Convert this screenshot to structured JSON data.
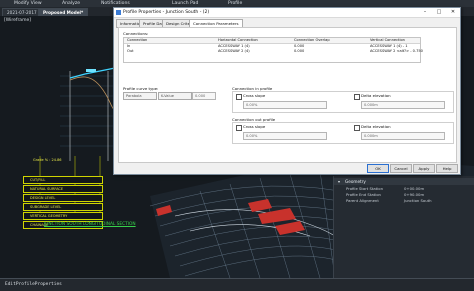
{
  "ribbon": {
    "items": [
      "Modify View",
      "Analyze",
      "Notifications",
      "Launch Pad",
      "Profile"
    ]
  },
  "document_tabs": [
    {
      "label": "2021-07-2017"
    },
    {
      "label": "Proposed Model*",
      "active": true
    }
  ],
  "viewport": {
    "view_label": "[Wireframe]",
    "grade_label": "Grade % : 24.86",
    "profile_rows": [
      "CUT/FILL",
      "NATURAL SURFACE",
      "DESIGN LEVEL",
      "SUBGRADE LEVEL",
      "VERTICAL GEOMETRY",
      "CHAINAGE"
    ],
    "section_title": "JUNCTION SOUTH LONGITUDINAL SECTION"
  },
  "dialog": {
    "title": "Profile Properties - Junction South - (2)",
    "tabs": [
      "Information",
      "Profile Data",
      "Design Criteria",
      "Connection Parameters"
    ],
    "active_tab": "Connection Parameters",
    "connections_label": "Connections:",
    "grid": {
      "headers": [
        "Connection",
        "Horizontal Connection",
        "Connection Overlap",
        "Vertical Connection"
      ],
      "rows": [
        [
          "In",
          "ACCESSWAY 1 (4)",
          "0.000",
          "ACCESSWAY 1 (4) - 1"
        ],
        [
          "Out",
          "ACCESSWAY 2 (4)",
          "0.000",
          "ACCESSWAY 2 <alt?> - 0.750"
        ]
      ]
    },
    "curve_type": {
      "label": "Profile curve type:",
      "type_value": "Parabola",
      "mode_value": "K-Value",
      "number_value": "0.000"
    },
    "conn_in_profile": {
      "title": "Connection in profile",
      "cross_slope_label": "Cross slope",
      "cross_slope_value": "0.00%",
      "delta_label": "Delta elevation",
      "delta_value": "0.000m"
    },
    "conn_out_profile": {
      "title": "Connection out profile",
      "cross_slope_label": "Cross slope",
      "cross_slope_value": "0.00%",
      "delta_label": "Delta elevation",
      "delta_value": "0.000m"
    },
    "buttons": {
      "ok": "OK",
      "cancel": "Cancel",
      "apply": "Apply",
      "help": "Help"
    }
  },
  "geometry_panel": {
    "header": "Geometry",
    "rows": [
      {
        "label": "Profile Start Station",
        "value": "0+00.00m"
      },
      {
        "label": "Profile End Station",
        "value": "0+90.00m"
      },
      {
        "label": "Parent Alignment",
        "value": "Junction South"
      }
    ]
  },
  "command_line": "EditProfileProperties",
  "colors": {
    "accent": "#2a6fd1",
    "profile_yellow": "#d6dc00",
    "section_green": "#36d14a",
    "deck_red": "#c8322c"
  }
}
